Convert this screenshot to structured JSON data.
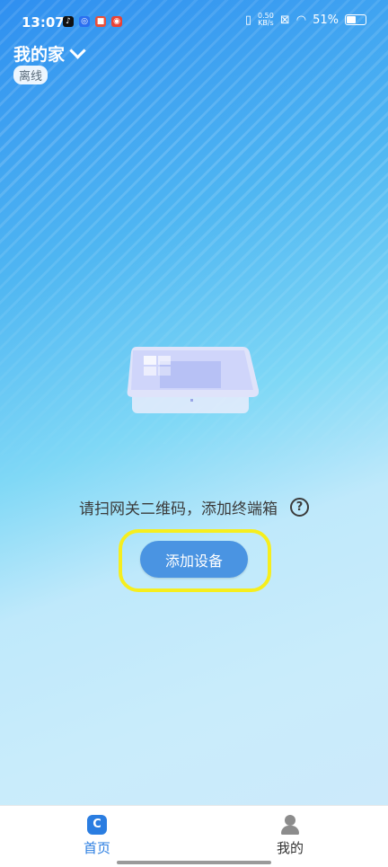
{
  "status_bar": {
    "time": "13:07",
    "net_speed_value": "0.50",
    "net_speed_unit": "KB/s",
    "battery": "51%"
  },
  "header": {
    "home_name": "我的家",
    "status_badge": "离线"
  },
  "main": {
    "prompt": "请扫网关二维码，添加终端箱",
    "help_glyph": "?",
    "add_button": "添加设备"
  },
  "tabs": [
    {
      "label": "首页",
      "icon": "home-icon",
      "active": true,
      "glyph": "C"
    },
    {
      "label": "我的",
      "icon": "person-icon",
      "active": false
    }
  ],
  "colors": {
    "accent": "#2a7de1",
    "button": "#4a94e2",
    "highlight": "#f6ee1e"
  }
}
